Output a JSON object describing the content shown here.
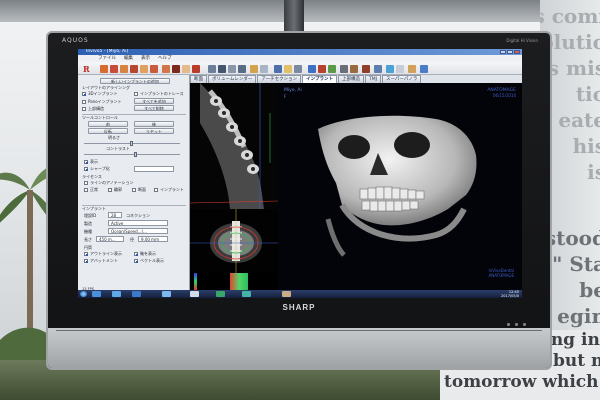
{
  "tv": {
    "model": "AQUOS",
    "spec": "Digital Hi Vision",
    "brand": "SHARP"
  },
  "window": {
    "title": "Invivo5 - [Miyo, Ai]"
  },
  "menu": {
    "items": [
      "ファイル",
      "編集",
      "表示",
      "ヘルプ"
    ]
  },
  "toolbar": {
    "logo": "R"
  },
  "tabs": {
    "items": [
      {
        "label": "断面"
      },
      {
        "label": "ボリュームレンダー"
      },
      {
        "label": "アーチセクション"
      },
      {
        "label": "インプラント",
        "active": true
      },
      {
        "label": "上部構造"
      },
      {
        "label": "TMJ"
      },
      {
        "label": "スーパーパノラ"
      }
    ]
  },
  "panel": {
    "add_implant": "新しいインプラントの追加",
    "layout": "レイアウトのアラインング",
    "checkbox_3d": "3Dインプラント",
    "checkbox_implant": "インプラントのトレース",
    "pano_implant": "Panoインプラント",
    "add_all": "すべてを追加",
    "upper": "上部構造",
    "delete_all": "すべて削除",
    "tools_label": "ツールコントロール",
    "btn_a": "前",
    "btn_b": "後",
    "btn_c": "反転",
    "btn_d": "リセット",
    "bright_label": "明るさ",
    "contrast_label": "コントラスト",
    "show_label": "表示",
    "sharpen_label": "シャープ化",
    "ruler_label": "ライセンス",
    "measure_label": "ラインのアノテーション",
    "opts": [
      "正常",
      "輪郭",
      "断面",
      "インプラント"
    ],
    "implant_section": "インプラント",
    "implant_id_label": "埋設ID",
    "implant_id_value": "28",
    "connect": "コネクション",
    "maker_label": "製造",
    "maker_value": "Active",
    "model_label": "機種",
    "model_value": "Ocean/Speed...(...",
    "length_label": "長さ",
    "length_value": "450 m...",
    "diameter_label": "径",
    "diameter_value": "9.00 mm",
    "drill_label": "円筒",
    "show_outline": "アウトライン表示",
    "show_axis": "軸を表示",
    "show_abut": "アバットメント",
    "show_vector": "ベクトル表示",
    "status": "13 FPS"
  },
  "viewport3d": {
    "patient": "Miyo, Ai",
    "flag": "F",
    "brand": "ANATOMAGE",
    "date": "06/15/2010",
    "brand_bottom": "InVivoDental",
    "brand_bottom2": "ANATOMAGE"
  },
  "taskbar": {
    "time": "12:45",
    "date": "2017/05/0"
  },
  "poster": {
    "lines": [
      "ess comi",
      "r solutio",
      "s mis",
      "tio",
      "eate",
      "his",
      "is",
      "stood",
      "\" Sta",
      "be",
      "egin"
    ],
    "bottom": [
      "ning in",
      "and hopes, but n",
      "tomorrow which"
    ]
  },
  "colors": {
    "screen_bg": "#dfe3ea",
    "title_bar": "#2d5fb3",
    "viewport_bg": "#000000",
    "accent_text": "#3d5fc4"
  }
}
